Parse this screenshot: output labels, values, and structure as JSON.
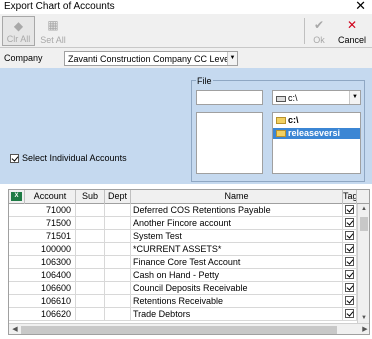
{
  "window": {
    "title": "Export Chart of Accounts"
  },
  "toolbar": {
    "clear_all": "Clr All",
    "set_all": "Set All",
    "ok": "Ok",
    "cancel": "Cancel"
  },
  "company": {
    "label": "Company",
    "value": "Zavanti Construction Company CC Level"
  },
  "file": {
    "label": "File",
    "filename_value": "",
    "drive": "c:\\",
    "directories": [
      {
        "name": "c:\\",
        "selected": false
      },
      {
        "name": "releaseversi",
        "selected": true
      }
    ]
  },
  "options": {
    "select_individual_label": "Select Individual Accounts",
    "select_individual_checked": true
  },
  "grid": {
    "excel_icon_label": "X",
    "columns": [
      "Account",
      "Sub",
      "Dept",
      "Name",
      "Tag"
    ],
    "rows": [
      {
        "account": "71000",
        "sub": "",
        "dept": "",
        "name": "Deferred COS Retentions Payable",
        "tag": true
      },
      {
        "account": "71500",
        "sub": "",
        "dept": "",
        "name": "Another Fincore account",
        "tag": true
      },
      {
        "account": "71501",
        "sub": "",
        "dept": "",
        "name": "System Test",
        "tag": true
      },
      {
        "account": "100000",
        "sub": "",
        "dept": "",
        "name": "*CURRENT ASSETS*",
        "tag": true
      },
      {
        "account": "106300",
        "sub": "",
        "dept": "",
        "name": "Finance Core Test Account",
        "tag": true
      },
      {
        "account": "106400",
        "sub": "",
        "dept": "",
        "name": "Cash on Hand - Petty",
        "tag": true
      },
      {
        "account": "106600",
        "sub": "",
        "dept": "",
        "name": "Council Deposits Receivable",
        "tag": true
      },
      {
        "account": "106610",
        "sub": "",
        "dept": "",
        "name": "Retentions Receivable",
        "tag": true
      },
      {
        "account": "106620",
        "sub": "",
        "dept": "",
        "name": "Trade Debtors",
        "tag": true
      }
    ]
  },
  "colors": {
    "config_panel_bg": "#c5d9ef",
    "selection_bg": "#3b86d4",
    "cancel_icon": "#d0021b",
    "excel_icon": "#1e7b45"
  },
  "icons": {
    "clear_all": "clear-all-icon",
    "set_all": "set-all-icon",
    "ok": "checkmark-icon",
    "cancel": "cancel-x-icon",
    "close": "close-icon",
    "drive": "hard-drive-icon",
    "folder": "folder-icon",
    "excel": "excel-icon"
  }
}
